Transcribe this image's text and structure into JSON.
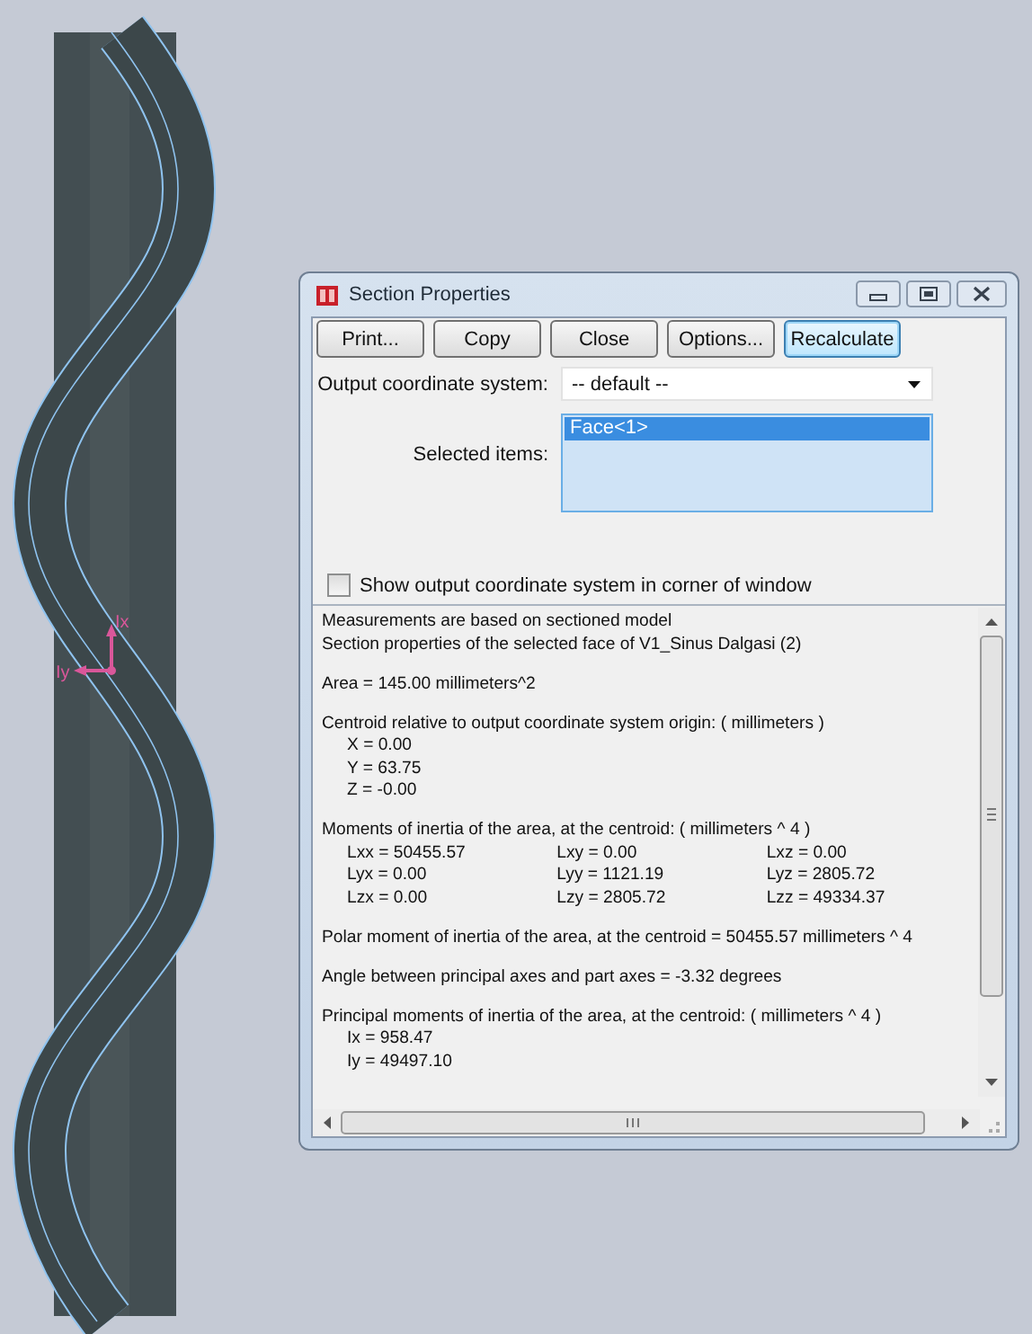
{
  "viewport": {
    "triad": {
      "x_label": "Ix",
      "y_label": "Iy"
    }
  },
  "window": {
    "title": "Section Properties"
  },
  "buttons": [
    {
      "label": "Print...",
      "focused": false
    },
    {
      "label": "Copy",
      "focused": false
    },
    {
      "label": "Close",
      "focused": false
    },
    {
      "label": "Options...",
      "focused": false
    },
    {
      "label": "Recalculate",
      "focused": true
    }
  ],
  "output_coordinate_system": {
    "label": "Output coordinate system:",
    "value": "-- default --"
  },
  "selected_items": {
    "label": "Selected items:",
    "items": [
      {
        "text": "Face<1>",
        "selected": true
      }
    ]
  },
  "show_coordinate_checkbox": {
    "label": "Show output coordinate system in corner of window",
    "checked": false
  },
  "report": [
    {
      "kind": "lines",
      "lines": [
        "Measurements are based on sectioned model",
        "Section properties of the selected face of V1_Sinus Dalgasi (2)"
      ]
    },
    {
      "kind": "lines",
      "lines": [
        "Area = 145.00 millimeters^2"
      ]
    },
    {
      "kind": "values",
      "heading": "Centroid relative to output coordinate system origin: ( millimeters )",
      "values": [
        "X = 0.00",
        "Y = 63.75",
        "Z = -0.00"
      ]
    },
    {
      "kind": "grid",
      "heading": "Moments of inertia of the area, at the centroid: ( millimeters ^ 4 )",
      "rows": [
        [
          "Lxx = 50455.57",
          "Lxy = 0.00",
          "Lxz = 0.00"
        ],
        [
          "Lyx = 0.00",
          "Lyy = 1121.19",
          "Lyz = 2805.72"
        ],
        [
          "Lzx = 0.00",
          "Lzy = 2805.72",
          "Lzz = 49334.37"
        ]
      ]
    },
    {
      "kind": "lines",
      "lines": [
        "Polar moment of inertia of the area, at the centroid = 50455.57 millimeters ^ 4"
      ]
    },
    {
      "kind": "lines",
      "lines": [
        "Angle between principal axes and part axes = -3.32 degrees"
      ]
    },
    {
      "kind": "values",
      "heading": "Principal moments of inertia of the area, at the centroid: ( millimeters ^ 4 )",
      "values": [
        "Ix = 958.47",
        "Iy = 49497.10"
      ]
    }
  ]
}
